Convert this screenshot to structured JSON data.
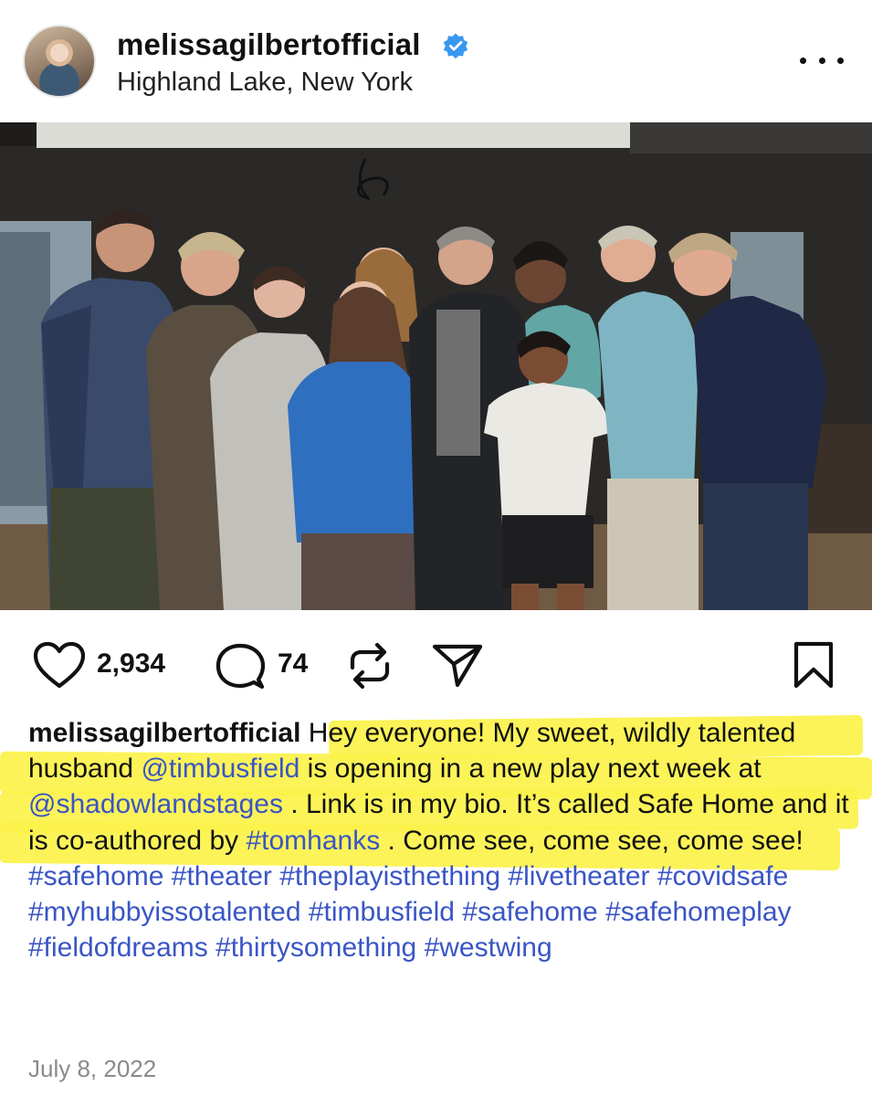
{
  "header": {
    "username": "melissagilbertofficial",
    "location": "Highland Lake, New York",
    "avatar_icon": "profile-photo",
    "verified_icon": "verified-badge-icon",
    "more_icon": "more-options-icon"
  },
  "post": {
    "image_icon": "group-photo"
  },
  "actions": {
    "likes": "2,934",
    "comments": "74",
    "like_icon": "heart-icon",
    "comment_icon": "comment-icon",
    "repost_icon": "repost-icon",
    "share_icon": "send-icon",
    "save_icon": "bookmark-icon"
  },
  "caption": {
    "user": "melissagilbertofficial",
    "text1": " Hey everyone! My sweet, wildly talented husband ",
    "mention1": "@timbusfield",
    "text2": "  is opening in a new play next week at ",
    "mention2": "@shadowlandstages",
    "text3": " . Link is in my bio. It’s called Safe Home and it is co-authored by ",
    "tag_tomhanks": "#tomhanks",
    "text4": " . Come see, come see, come see! ",
    "tag1": "#safehome",
    "tag2": "#theater",
    "tag3": "#theplayisthething",
    "tag4": "#livetheater",
    "tag5": "#covidsafe",
    "tag6": "#myhubbyissotalented",
    "tag7": "#timbusfield",
    "tag8": "#safehome",
    "tag9": "#safehomeplay",
    "tag10": "#fieldofdreams",
    "tag11": "#thirtysomething",
    "tag12": "#westwing"
  },
  "date": "July 8, 2022",
  "colors": {
    "link": "#3a55c4",
    "verified": "#3897f0",
    "highlight": "#fbf24a",
    "date": "#8a8a8a"
  }
}
